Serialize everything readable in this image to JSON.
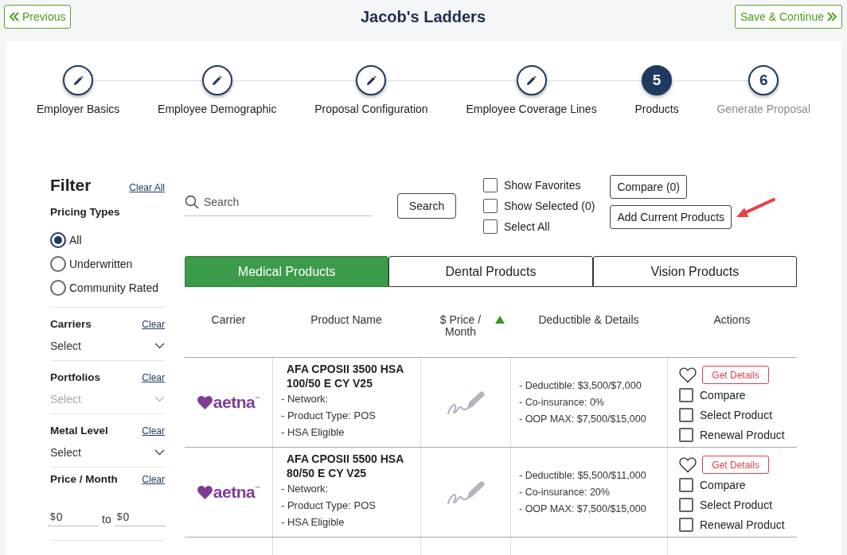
{
  "header": {
    "back_button": "Previous",
    "title": "Jacob's Ladders",
    "next_button": "Save & Continue"
  },
  "steps": [
    {
      "label": "Employer Basics",
      "completed": true,
      "selected": false
    },
    {
      "label": "Employee Demographic",
      "completed": true,
      "selected": false
    },
    {
      "label": "Proposal Configuration",
      "completed": true,
      "selected": false
    },
    {
      "label": "Employee Coverage Lines",
      "completed": true,
      "selected": false
    },
    {
      "label": "Products",
      "number": "5",
      "completed": false,
      "selected": true
    },
    {
      "label": "Generate Proposal",
      "number": "6",
      "completed": false,
      "selected": false
    }
  ],
  "filter": {
    "title": "Filter",
    "clear_all": "Clear All",
    "pricing_types": {
      "label": "Pricing Types",
      "options": [
        {
          "label": "All",
          "selected": true
        },
        {
          "label": "Underwritten",
          "selected": false
        },
        {
          "label": "Community Rated",
          "selected": false
        }
      ]
    },
    "dropdowns": [
      {
        "label": "Carriers",
        "clear": "Clear",
        "placeholder": "Select",
        "disabled": false
      },
      {
        "label": "Portfolios",
        "clear": "Clear",
        "placeholder": "Select",
        "disabled": true
      },
      {
        "label": "Metal Level",
        "clear": "Clear",
        "placeholder": "Select",
        "disabled": false
      }
    ],
    "price": {
      "label": "Price / Month",
      "clear": "Clear",
      "min": {
        "prefix": "$",
        "value": "0"
      },
      "separator": "to",
      "max": {
        "prefix": "$",
        "value": "0"
      }
    }
  },
  "toolbar": {
    "search": {
      "placeholder": "Search"
    },
    "search_button": "Search",
    "toggles": [
      {
        "label": "Show Favorites",
        "checked": false
      },
      {
        "label": "Show Selected (0)",
        "checked": false
      },
      {
        "label": "Select All",
        "checked": false
      }
    ],
    "compare_button": "Compare (0)",
    "add_current_button": "Add Current Products"
  },
  "tabs": [
    {
      "label": "Medical Products",
      "selected": true
    },
    {
      "label": "Dental Products",
      "selected": false
    },
    {
      "label": "Vision Products",
      "selected": false
    }
  ],
  "table": {
    "columns": [
      {
        "label": "Carrier",
        "sorted": false
      },
      {
        "label": "Product Name",
        "sorted": false
      },
      {
        "label": "$ Price / Month",
        "sorted": true
      },
      {
        "label": "Deductible & Details",
        "sorted": false
      },
      {
        "label": "Actions",
        "sorted": false
      }
    ],
    "rows": [
      {
        "carrier": "aetna$^{™}$",
        "product_name": "AFA CPOSII 3500 HSA 100/50 E CY V25",
        "product_details": [
          "- Network:",
          "- Product Type: POS",
          "- HSA Eligible"
        ],
        "deductible_details": [
          "- Deductible: $3,500/$7,000",
          "- Co-insurance: 0%",
          "- OOP MAX: $7,500/$15,000"
        ],
        "favorite": false,
        "details_button": "Get Details",
        "options": [
          {
            "label": "Compare",
            "checked": false
          },
          {
            "label": "Select Product",
            "checked": false
          },
          {
            "label": "Renewal Product",
            "checked": false
          }
        ]
      },
      {
        "carrier": "aetna$^{™}$",
        "product_name": "AFA CPOSII 5500 HSA 80/50 E CY V25",
        "product_details": [
          "- Network:",
          "- Product Type: POS",
          "- HSA Eligible"
        ],
        "deductible_details": [
          "- Deductible: $5,500/$11,000",
          "- Co-insurance: 20%",
          "- OOP MAX: $7,500/$15,000"
        ],
        "favorite": false,
        "details_button": "Get Details",
        "options": [
          {
            "label": "Compare",
            "checked": false
          },
          {
            "label": "Select Product",
            "checked": false
          },
          {
            "label": "Renewal Product",
            "checked": false
          }
        ]
      }
    ]
  }
}
